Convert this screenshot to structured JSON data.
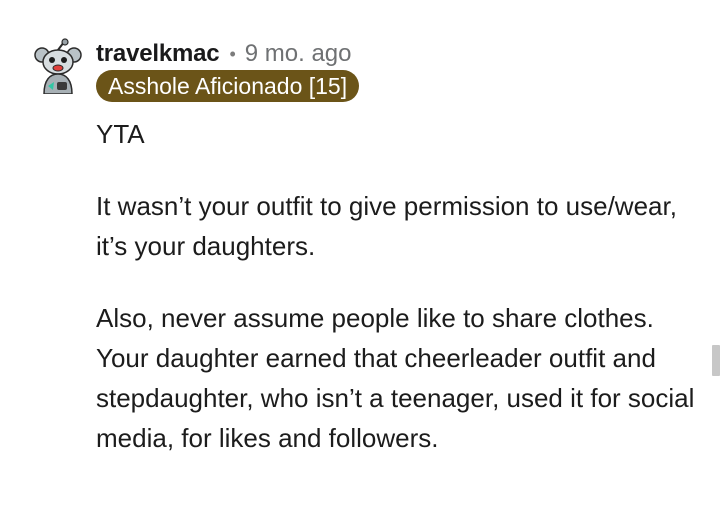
{
  "comment": {
    "username": "travelkmac",
    "separator": "•",
    "timestamp": "9 mo. ago",
    "flair": "Asshole Aficionado [15]",
    "avatar_icon": "reddit-snoo-avatar-icon",
    "paragraphs": [
      "YTA",
      "It wasn’t your outfit to give permission to use/wear, it’s your daughters.",
      "Also, never assume people like to share clothes. Your daughter earned that cheerleader outfit and stepdaughter, who isn’t a teenager, used it for social media, for likes and followers."
    ]
  },
  "colors": {
    "flair_bg": "#6b5418",
    "flair_text": "#ffffff",
    "meta_text": "#6f7173"
  }
}
